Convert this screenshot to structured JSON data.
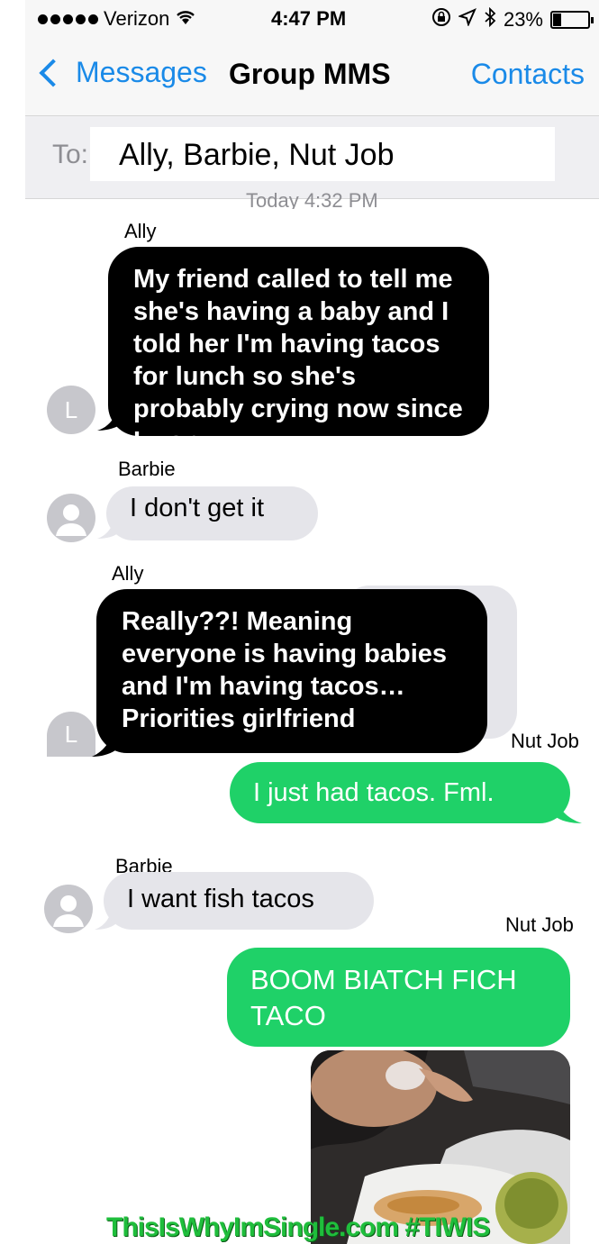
{
  "status": {
    "carrier": "Verizon",
    "time": "4:47 PM",
    "battery": "23%",
    "battery_level": 0.23
  },
  "nav": {
    "back_label": "Messages",
    "title": "Group MMS",
    "contacts_label": "Contacts"
  },
  "to": {
    "label": "To:",
    "value": "Ally, Barbie, Nut Job"
  },
  "timestamp": "Today 4:32 PM",
  "messages": [
    {
      "sender": "Ally",
      "avatar": "L",
      "text": "My friend called to tell me she's having a baby and I told her I'm having tacos for lunch so she's probably crying now since I won."
    },
    {
      "sender": "Barbie",
      "text": "I don't get it"
    },
    {
      "sender": "Ally",
      "avatar": "L",
      "text": "Really??! Meaning everyone is having babies and I'm having tacos… Priorities girlfriend"
    },
    {
      "sender": "Nut Job",
      "text": "I just had tacos. Fml."
    },
    {
      "sender": "Barbie",
      "text": "I want fish tacos"
    },
    {
      "sender": "Nut Job",
      "text": "BOOM BIATCH FICH TACO"
    }
  ],
  "watermark": "ThisIsWhyImSingle.com  #TIWIS",
  "colors": {
    "accent": "#1a8ae8",
    "green_bubble": "#1fd168",
    "gray_bubble": "#e5e5ea",
    "black_bubble": "#000000"
  }
}
